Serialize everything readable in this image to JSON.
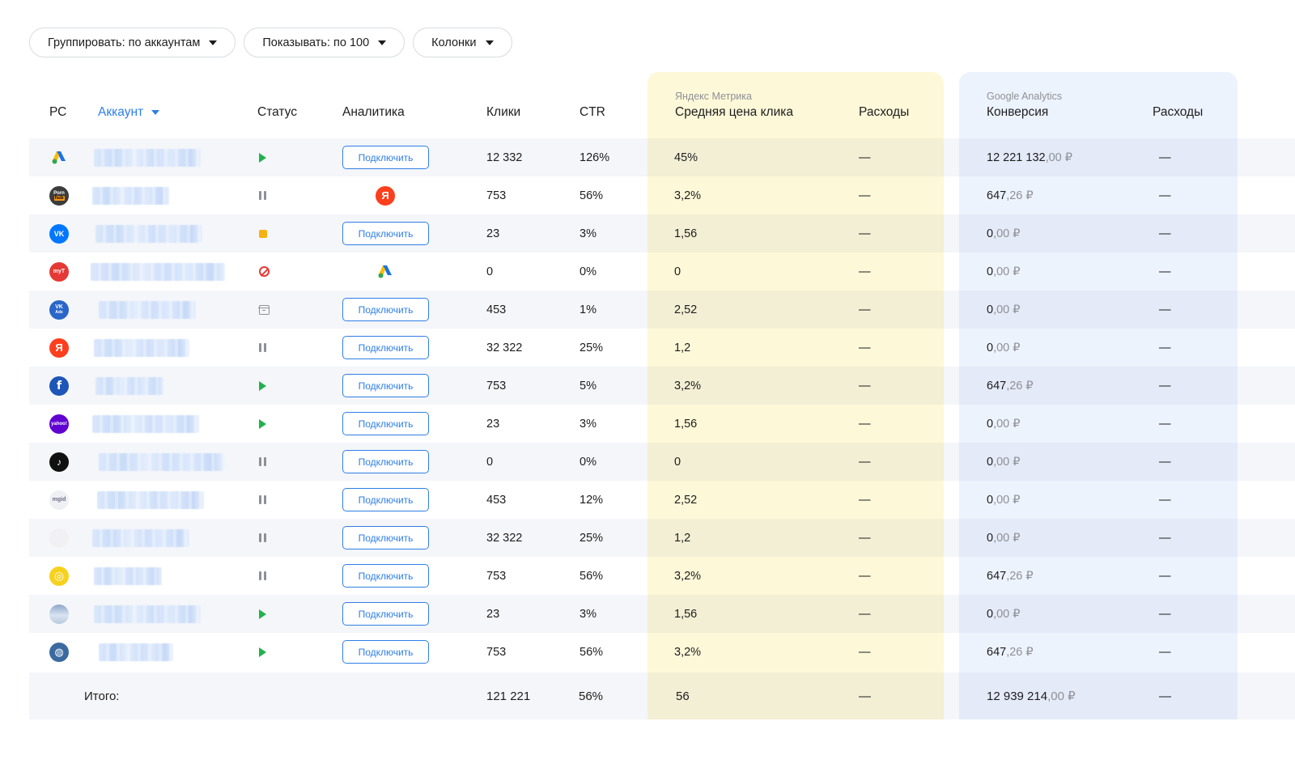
{
  "toolbar": {
    "group_label": "Группировать: по аккаунтам",
    "show_label": "Показывать: по 100",
    "columns_label": "Колонки"
  },
  "columns": {
    "rs": "РС",
    "account": "Аккаунт",
    "status": "Статус",
    "analytics": "Аналитика",
    "clicks": "Клики",
    "ctr": "CTR",
    "ym_group": "Яндекс Метрика",
    "ym_cpc": "Средняя цена клика",
    "ym_spend": "Расходы",
    "ga_group": "Google Analytics",
    "ga_conv": "Конверсия",
    "ga_spend": "Расходы"
  },
  "connect_label": "Подключить",
  "colors": {
    "accent": "#2e7fe6",
    "yandex_panel": "#fdf8d8",
    "google_panel": "#edf3fd",
    "play": "#22b14c"
  },
  "rows": [
    {
      "icon": "google-ads-icon",
      "status": "active",
      "analytics": "connect-button",
      "clicks": "12 332",
      "ctr": "126%",
      "ym_cpc": "45%",
      "ym_spend": "—",
      "ga_int": "12 221 132",
      "ga_dec": ",00 ₽",
      "ga_spend": "—"
    },
    {
      "icon": "pornhub-icon",
      "status": "paused",
      "analytics": "yandex-icon",
      "clicks": "753",
      "ctr": "56%",
      "ym_cpc": "3,2%",
      "ym_spend": "—",
      "ga_int": "647",
      "ga_dec": ",26 ₽",
      "ga_spend": "—"
    },
    {
      "icon": "vk-icon",
      "status": "stopped",
      "analytics": "connect-button",
      "clicks": "23",
      "ctr": "3%",
      "ym_cpc": "1,56",
      "ym_spend": "—",
      "ga_int": "0",
      "ga_dec": ",00 ₽",
      "ga_spend": "—"
    },
    {
      "icon": "mytarget-icon",
      "status": "blocked",
      "analytics": "google-ads-icon",
      "clicks": "0",
      "ctr": "0%",
      "ym_cpc": "0",
      "ym_spend": "—",
      "ga_int": "0",
      "ga_dec": ",00 ₽",
      "ga_spend": "—"
    },
    {
      "icon": "vk-ads-icon",
      "status": "archived",
      "analytics": "connect-button",
      "clicks": "453",
      "ctr": "1%",
      "ym_cpc": "2,52",
      "ym_spend": "—",
      "ga_int": "0",
      "ga_dec": ",00 ₽",
      "ga_spend": "—"
    },
    {
      "icon": "yandex-icon",
      "status": "paused",
      "analytics": "connect-button",
      "clicks": "32 322",
      "ctr": "25%",
      "ym_cpc": "1,2",
      "ym_spend": "—",
      "ga_int": "0",
      "ga_dec": ",00 ₽",
      "ga_spend": "—"
    },
    {
      "icon": "facebook-icon",
      "status": "active",
      "analytics": "connect-button",
      "clicks": "753",
      "ctr": "5%",
      "ym_cpc": "3,2%",
      "ym_spend": "—",
      "ga_int": "647",
      "ga_dec": ",26 ₽",
      "ga_spend": "—"
    },
    {
      "icon": "yahoo-icon",
      "status": "active",
      "analytics": "connect-button",
      "clicks": "23",
      "ctr": "3%",
      "ym_cpc": "1,56",
      "ym_spend": "—",
      "ga_int": "0",
      "ga_dec": ",00 ₽",
      "ga_spend": "—"
    },
    {
      "icon": "tiktok-icon",
      "status": "paused",
      "analytics": "connect-button",
      "clicks": "0",
      "ctr": "0%",
      "ym_cpc": "0",
      "ym_spend": "—",
      "ga_int": "0",
      "ga_dec": ",00 ₽",
      "ga_spend": "—"
    },
    {
      "icon": "mgid-icon",
      "status": "paused",
      "analytics": "connect-button",
      "clicks": "453",
      "ctr": "12%",
      "ym_cpc": "2,52",
      "ym_spend": "—",
      "ga_int": "0",
      "ga_dec": ",00 ₽",
      "ga_spend": "—"
    },
    {
      "icon": "apple-icon",
      "status": "paused",
      "analytics": "connect-button",
      "clicks": "32 322",
      "ctr": "25%",
      "ym_cpc": "1,2",
      "ym_spend": "—",
      "ga_int": "0",
      "ga_dec": ",00 ₽",
      "ga_spend": "—"
    },
    {
      "icon": "yellow-spiral-icon",
      "status": "paused",
      "analytics": "connect-button",
      "clicks": "753",
      "ctr": "56%",
      "ym_cpc": "3,2%",
      "ym_spend": "—",
      "ga_int": "647",
      "ga_dec": ",26 ₽",
      "ga_spend": "—"
    },
    {
      "icon": "mountain-icon",
      "status": "active",
      "analytics": "connect-button",
      "clicks": "23",
      "ctr": "3%",
      "ym_cpc": "1,56",
      "ym_spend": "—",
      "ga_int": "0",
      "ga_dec": ",00 ₽",
      "ga_spend": "—"
    },
    {
      "icon": "globe-icon",
      "status": "active",
      "analytics": "connect-button",
      "clicks": "753",
      "ctr": "56%",
      "ym_cpc": "3,2%",
      "ym_spend": "—",
      "ga_int": "647",
      "ga_dec": ",26 ₽",
      "ga_spend": "—"
    }
  ],
  "total": {
    "label": "Итого:",
    "clicks": "121 221",
    "ctr": "56%",
    "ym_cpc": "56",
    "ym_spend": "—",
    "ga_int": "12 939 214",
    "ga_dec": ",00 ₽",
    "ga_spend": "—"
  }
}
